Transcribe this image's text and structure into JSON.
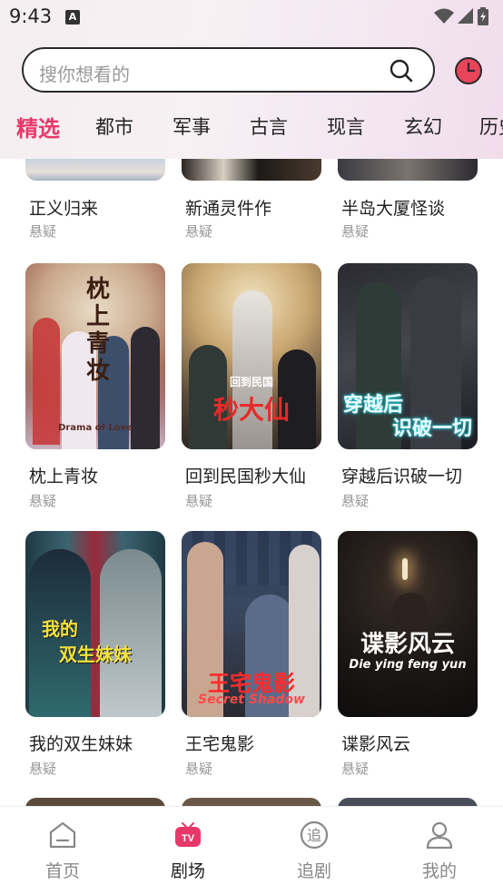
{
  "status_bar": {
    "time": "9:43",
    "notification_icon": "A"
  },
  "search": {
    "placeholder": "搜你想看的"
  },
  "tabs": [
    {
      "label": "精选",
      "active": true
    },
    {
      "label": "都市"
    },
    {
      "label": "军事"
    },
    {
      "label": "古言"
    },
    {
      "label": "现言"
    },
    {
      "label": "玄幻"
    },
    {
      "label": "历史"
    }
  ],
  "top_row": [
    {
      "title": "正义归来",
      "tag": "悬疑"
    },
    {
      "title": "新通灵件作",
      "tag": "悬疑"
    },
    {
      "title": "半岛大厦怪谈",
      "tag": "悬疑"
    }
  ],
  "dramas": [
    {
      "title": "枕上青妆",
      "tag": "悬疑",
      "poster_text": "枕上青妆",
      "poster_subtext": "Drama of Love"
    },
    {
      "title": "回到民国秒大仙",
      "tag": "悬疑",
      "poster_text": "秒大仙",
      "poster_subtext": "回到民国"
    },
    {
      "title": "穿越后识破一切",
      "tag": "悬疑",
      "poster_text": "穿越后",
      "poster_subtext": "识破一切"
    },
    {
      "title": "我的双生妹妹",
      "tag": "悬疑",
      "poster_text": "我的",
      "poster_subtext": "双生妹妹"
    },
    {
      "title": "王宅鬼影",
      "tag": "悬疑",
      "poster_text": "王宅鬼影",
      "poster_subtext": "Secret Shadow"
    },
    {
      "title": "谍影风云",
      "tag": "悬疑",
      "poster_text": "谍影风云",
      "poster_subtext": "Die ying feng yun"
    }
  ],
  "bottom_nav": [
    {
      "label": "首页",
      "icon": "home-icon"
    },
    {
      "label": "剧场",
      "icon": "tv-icon",
      "active": true
    },
    {
      "label": "追剧",
      "icon": "follow-icon"
    },
    {
      "label": "我的",
      "icon": "profile-icon"
    }
  ],
  "colors": {
    "accent": "#e8386a",
    "history": "#e8445a",
    "tv_badge": "#e8386a"
  }
}
